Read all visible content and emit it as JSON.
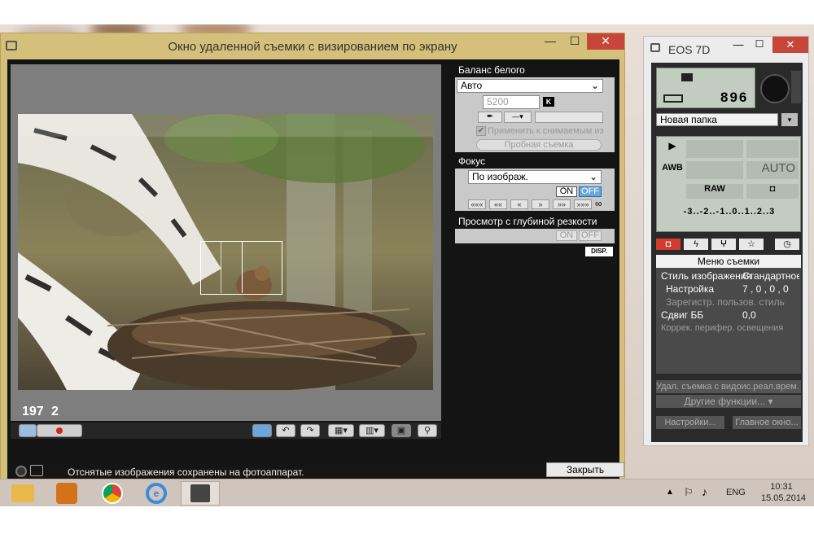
{
  "main_window": {
    "title": "Окно удаленной съемки с визированием по экрану",
    "min_glyph": "—",
    "max_glyph": "☐",
    "close_glyph": "✕",
    "frame_counter_a": "197",
    "frame_counter_b": "2",
    "status_text": "Отснятые изображения сохранены на фотоаппарат.",
    "close_button": "Закрыть"
  },
  "white_balance": {
    "header": "Баланс белого",
    "mode": "Авто",
    "kelvin_value": "5200",
    "kelvin_unit": "K",
    "apply_checkbox": "Применить к снимаемым из",
    "test_shot_button": "Пробная съемка"
  },
  "focus": {
    "header": "Фокус",
    "mode": "По изображ.",
    "on_label": "ON",
    "off_label": "OFF",
    "infinity": "∞",
    "nav_buttons": [
      "«««",
      "««",
      "«",
      "»",
      "»»",
      "»»»"
    ]
  },
  "dof_preview": {
    "header": "Просмотр с глубиной резкости",
    "on_label": "ON",
    "off_label": "OFF",
    "disp_label": "DISP."
  },
  "toolbar": {
    "record_icon": "record-icon"
  },
  "eos_window": {
    "title": "EOS 7D",
    "shots_remaining": "896",
    "folder": "Новая папка",
    "wb_label": "AWB",
    "wb_auto": "AUTO",
    "quality": "RAW",
    "exposure_scale": "-3..-2..-1..0..1..2..3",
    "menu_title": "Меню съемки",
    "menu_rows": [
      {
        "label": "Стиль изображения",
        "value": "Стандартное"
      },
      {
        "label": "Настройка",
        "value": "7 , 0 , 0 , 0"
      },
      {
        "label": "Зарегистр. пользов. стиль",
        "value": ""
      },
      {
        "label": "Сдвиг ББ",
        "value": "0,0"
      },
      {
        "label": "Коррек. перифер. освещения",
        "value": ""
      }
    ],
    "live_view_button": "Удал. съемка с видоис.реал.врем.",
    "other_functions": "Другие функции...",
    "settings_button": "Настройки...",
    "main_window_button": "Главное окно..."
  },
  "taskbar": {
    "language": "ENG",
    "time": "10:31",
    "date": "15.05.2014"
  },
  "colors": {
    "window_border": "#d4c07a",
    "close_red": "#c7463a",
    "panel_dark": "#141414"
  }
}
